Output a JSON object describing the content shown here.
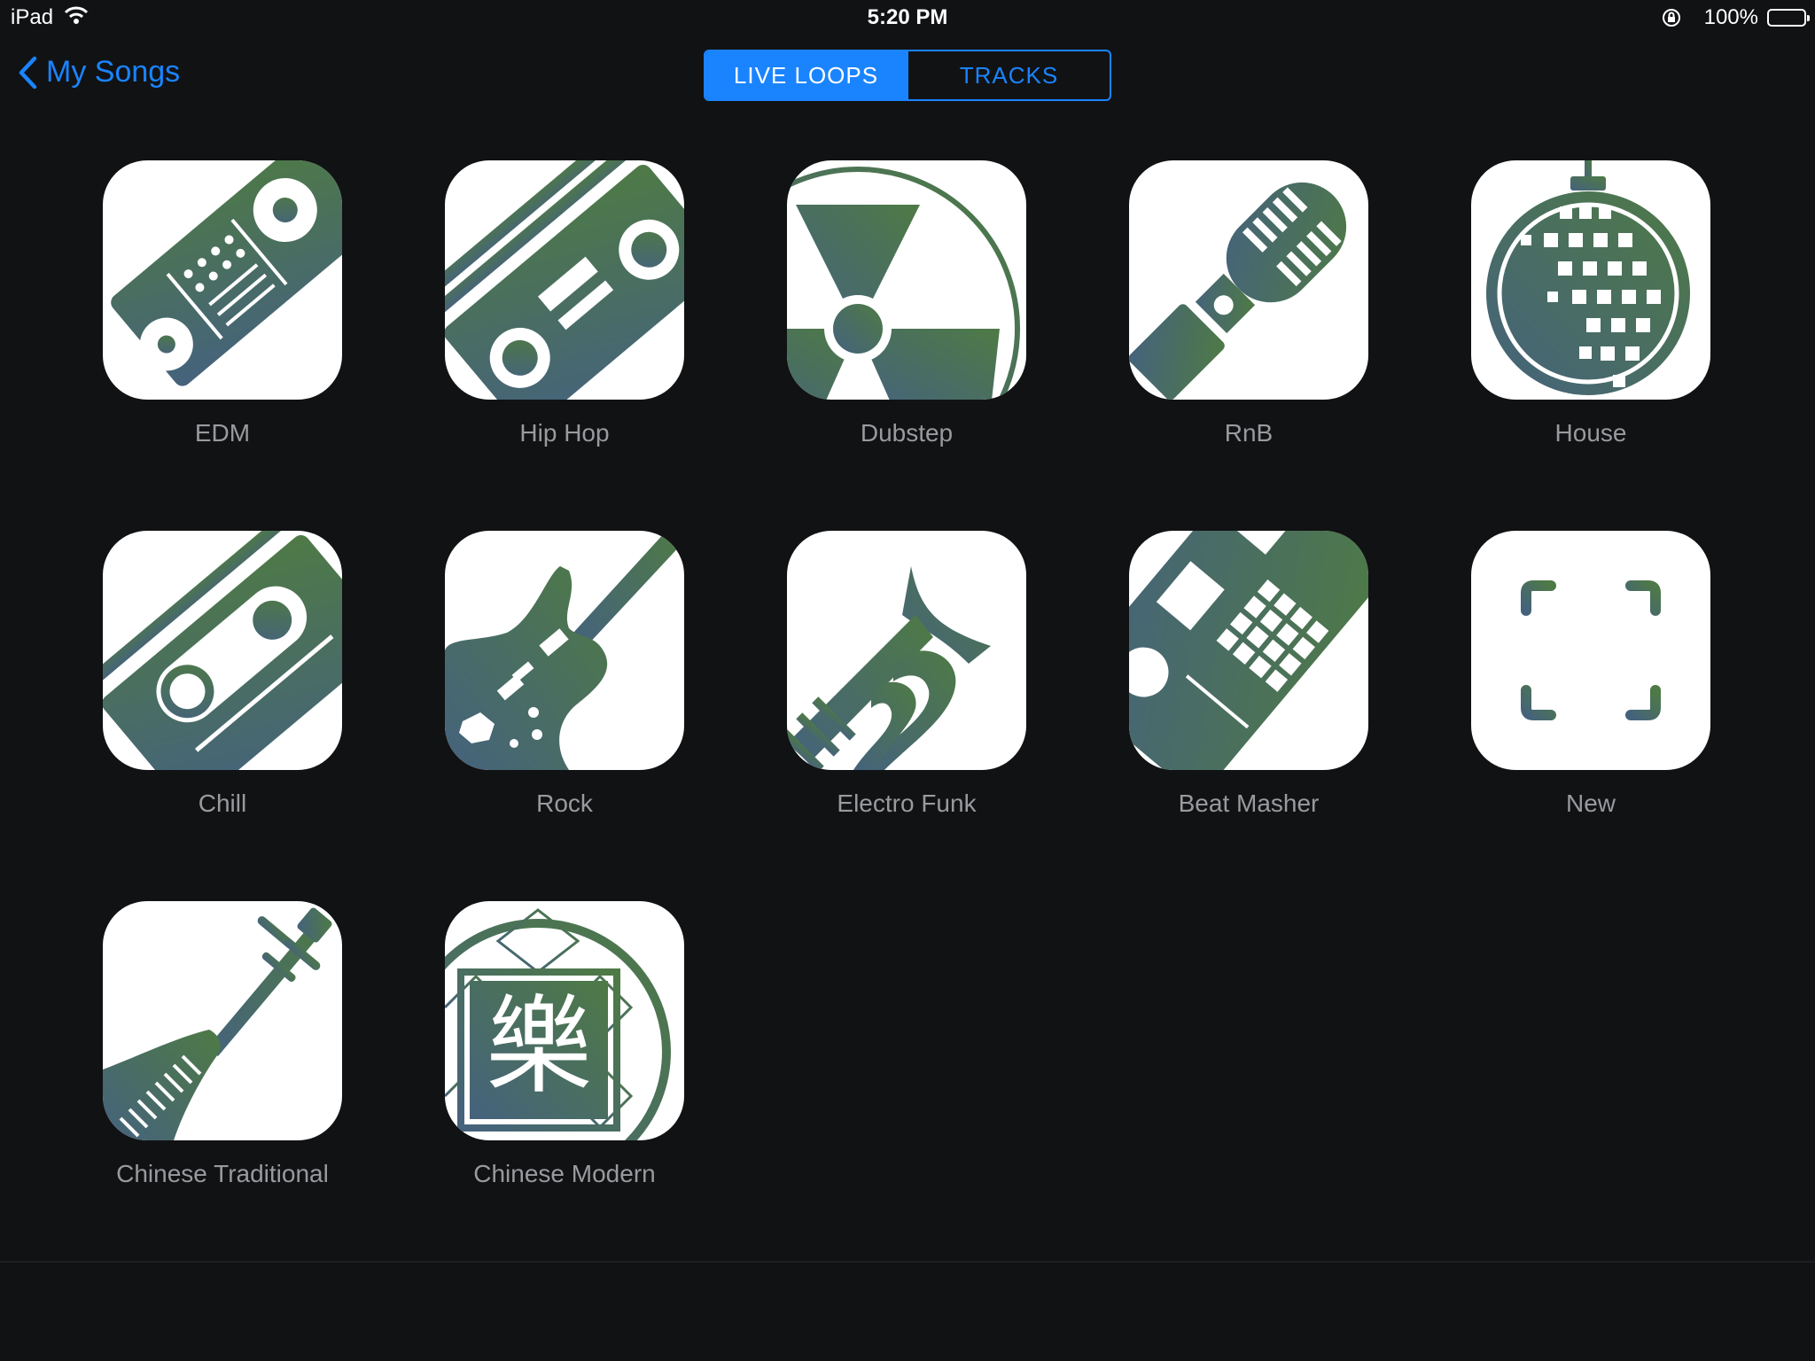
{
  "status_bar": {
    "device": "iPad",
    "time": "5:20 PM",
    "battery": "100%",
    "battery_level": 1.0
  },
  "nav": {
    "back_label": "My Songs",
    "segments": [
      {
        "label": "LIVE LOOPS",
        "active": true
      },
      {
        "label": "TRACKS",
        "active": false
      }
    ]
  },
  "colors": {
    "accent": "#1a84ff",
    "background": "#111214",
    "label": "#9a9a9e",
    "icon_green": "#4e7a45",
    "icon_blue": "#45627d"
  },
  "templates": [
    {
      "label": "EDM",
      "icon": "dj-controller-icon"
    },
    {
      "label": "Hip Hop",
      "icon": "boombox-icon"
    },
    {
      "label": "Dubstep",
      "icon": "radiation-disc-icon"
    },
    {
      "label": "RnB",
      "icon": "microphone-icon"
    },
    {
      "label": "House",
      "icon": "disco-ball-icon"
    },
    {
      "label": "Chill",
      "icon": "cassette-player-icon"
    },
    {
      "label": "Rock",
      "icon": "electric-guitar-icon"
    },
    {
      "label": "Electro Funk",
      "icon": "trumpet-icon"
    },
    {
      "label": "Beat Masher",
      "icon": "drum-pad-icon"
    },
    {
      "label": "New",
      "icon": "new-template-icon"
    },
    {
      "label": "Chinese Traditional",
      "icon": "pipa-icon"
    },
    {
      "label": "Chinese Modern",
      "icon": "chinese-music-character-icon"
    }
  ],
  "chinese_modern_glyph": "樂"
}
